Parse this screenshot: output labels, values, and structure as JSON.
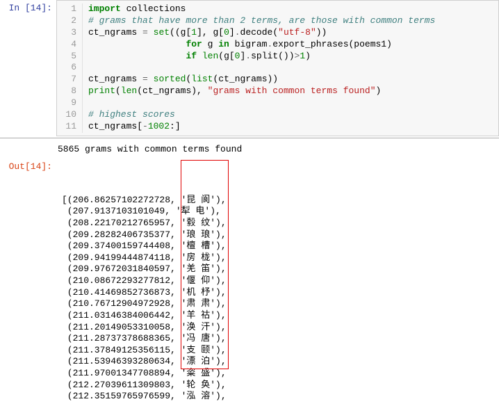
{
  "exec_count": 14,
  "prompts": {
    "in": "In [14]:",
    "out": "Out[14]:"
  },
  "code": {
    "lines": [
      {
        "n": 1,
        "tokens": [
          [
            "kw",
            "import"
          ],
          [
            "nm",
            " collections"
          ]
        ]
      },
      {
        "n": 2,
        "tokens": [
          [
            "cm",
            "# grams that have more than 2 terms, are those with common terms"
          ]
        ]
      },
      {
        "n": 3,
        "tokens": [
          [
            "nm",
            "ct_ngrams "
          ],
          [
            "op",
            "="
          ],
          [
            "nm",
            " "
          ],
          [
            "bi",
            "set"
          ],
          [
            "nm",
            "((g["
          ],
          [
            "num",
            "1"
          ],
          [
            "nm",
            "], g["
          ],
          [
            "num",
            "0"
          ],
          [
            "nm",
            "]"
          ],
          [
            "op",
            "."
          ],
          [
            "nm",
            "decode("
          ],
          [
            "st",
            "\"utf-8\""
          ],
          [
            "nm",
            "))"
          ]
        ]
      },
      {
        "n": 4,
        "tokens": [
          [
            "nm",
            "                  "
          ],
          [
            "kw",
            "for"
          ],
          [
            "nm",
            " g "
          ],
          [
            "kw",
            "in"
          ],
          [
            "nm",
            " bigram"
          ],
          [
            "op",
            "."
          ],
          [
            "nm",
            "export_phrases(poems1)"
          ]
        ]
      },
      {
        "n": 5,
        "tokens": [
          [
            "nm",
            "                  "
          ],
          [
            "kw",
            "if"
          ],
          [
            "nm",
            " "
          ],
          [
            "bi",
            "len"
          ],
          [
            "nm",
            "(g["
          ],
          [
            "num",
            "0"
          ],
          [
            "nm",
            "]"
          ],
          [
            "op",
            "."
          ],
          [
            "nm",
            "split())"
          ],
          [
            "op",
            ">"
          ],
          [
            "num",
            "1"
          ],
          [
            "nm",
            ")"
          ]
        ]
      },
      {
        "n": 6,
        "tokens": [
          [
            "nm",
            ""
          ]
        ]
      },
      {
        "n": 7,
        "tokens": [
          [
            "nm",
            "ct_ngrams "
          ],
          [
            "op",
            "="
          ],
          [
            "nm",
            " "
          ],
          [
            "bi",
            "sorted"
          ],
          [
            "nm",
            "("
          ],
          [
            "bi",
            "list"
          ],
          [
            "nm",
            "(ct_ngrams))"
          ]
        ]
      },
      {
        "n": 8,
        "tokens": [
          [
            "bi",
            "print"
          ],
          [
            "nm",
            "("
          ],
          [
            "bi",
            "len"
          ],
          [
            "nm",
            "(ct_ngrams), "
          ],
          [
            "st",
            "\"grams with common terms found\""
          ],
          [
            "nm",
            ")"
          ]
        ]
      },
      {
        "n": 9,
        "tokens": [
          [
            "nm",
            ""
          ]
        ]
      },
      {
        "n": 10,
        "tokens": [
          [
            "cm",
            "# highest scores"
          ]
        ]
      },
      {
        "n": 11,
        "tokens": [
          [
            "nm",
            "ct_ngrams["
          ],
          [
            "op",
            "-"
          ],
          [
            "num",
            "1002"
          ],
          [
            "nm",
            ":]"
          ]
        ]
      }
    ]
  },
  "stream_output": "5865 grams with common terms found",
  "result_rows": [
    {
      "prefix": "[(",
      "score": "206.86257102272728",
      "term": "'昆 阆'),"
    },
    {
      "prefix": " (",
      "score": "207.9137103101049",
      "term": "'犁 电'),"
    },
    {
      "prefix": " (",
      "score": "208.22170212765957",
      "term": "'縠 纹'),"
    },
    {
      "prefix": " (",
      "score": "209.28282406735377",
      "term": "'琅 琅'),"
    },
    {
      "prefix": " (",
      "score": "209.37400159744408",
      "term": "'檀 槽'),"
    },
    {
      "prefix": " (",
      "score": "209.94199444874118",
      "term": "'房 栊'),"
    },
    {
      "prefix": " (",
      "score": "209.97672031840597",
      "term": "'羌 笛'),"
    },
    {
      "prefix": " (",
      "score": "210.08672293277812",
      "term": "'偃 仰'),"
    },
    {
      "prefix": " (",
      "score": "210.41469852736873",
      "term": "'机 杼'),"
    },
    {
      "prefix": " (",
      "score": "210.76712904972928",
      "term": "'肃 肃'),"
    },
    {
      "prefix": " (",
      "score": "211.03146384006442",
      "term": "'羊 祜'),"
    },
    {
      "prefix": " (",
      "score": "211.20149053310058",
      "term": "'涣 汗'),"
    },
    {
      "prefix": " (",
      "score": "211.28737378688365",
      "term": "'冯 唐'),"
    },
    {
      "prefix": " (",
      "score": "211.37849125356115",
      "term": "'支 颐'),"
    },
    {
      "prefix": " (",
      "score": "211.53946393280634",
      "term": "'漂 泊'),"
    },
    {
      "prefix": " (",
      "score": "211.97001347708894",
      "term": "'粢 盛'),"
    },
    {
      "prefix": " (",
      "score": "212.27039611309803",
      "term": "'轮 奂'),"
    },
    {
      "prefix": " (",
      "score": "212.35159765976599",
      "term": "'泓 溶'),"
    }
  ]
}
